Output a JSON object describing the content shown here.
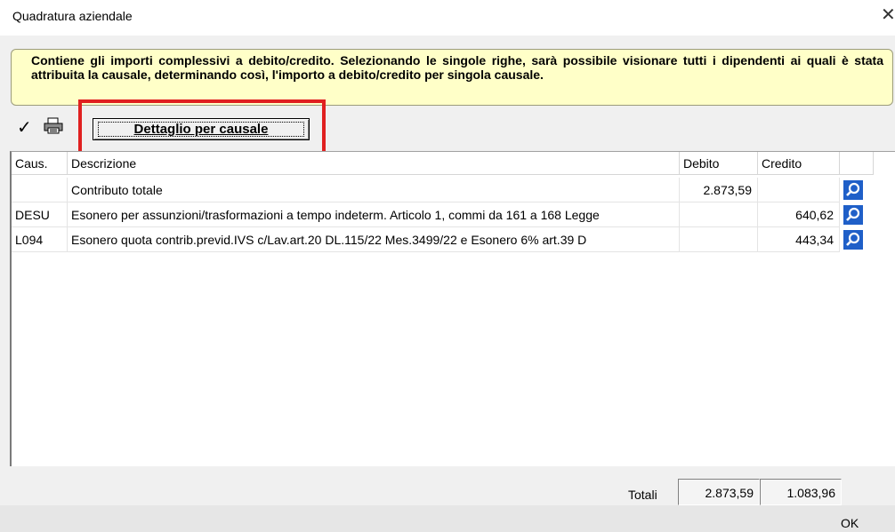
{
  "window": {
    "title": "Quadratura aziendale",
    "close_glyph": "✕"
  },
  "info_text": "Contiene gli importi complessivi a debito/credito. Selezionando le singole righe, sarà possibile visionare tutti i dipendenti ai quali è stata attribuita la causale, determinando così, l'importo a debito/credito per singola causale.",
  "toolbar": {
    "confirm_icon": "checkmark-icon",
    "print_icon": "printer-icon",
    "detail_button_label": "Dettaglio per causale"
  },
  "table": {
    "headers": {
      "caus": "Caus.",
      "descrizione": "Descrizione",
      "debito": "Debito",
      "credito": "Credito"
    },
    "rows": [
      {
        "caus": "",
        "descrizione": "Contributo totale",
        "debito": "2.873,59",
        "credito": ""
      },
      {
        "caus": "DESU",
        "descrizione": "Esonero per assunzioni/trasformazioni a tempo indeterm. Articolo 1, commi da 161 a 168 Legge",
        "debito": "",
        "credito": "640,62"
      },
      {
        "caus": "L094",
        "descrizione": "Esonero quota contrib.previd.IVS c/Lav.art.20 DL.115/22 Mes.3499/22 e Esonero 6% art.39 D",
        "debito": "",
        "credito": "443,34"
      }
    ],
    "row_action_icon": "magnifier-icon"
  },
  "totals": {
    "label": "Totali",
    "debito": "2.873,59",
    "credito": "1.083,96"
  },
  "footer": {
    "ok_label": "OK"
  },
  "colors": {
    "info_bg": "#ffffc8",
    "highlight": "#e02020",
    "magnifier_bg": "#1f5fc8"
  }
}
